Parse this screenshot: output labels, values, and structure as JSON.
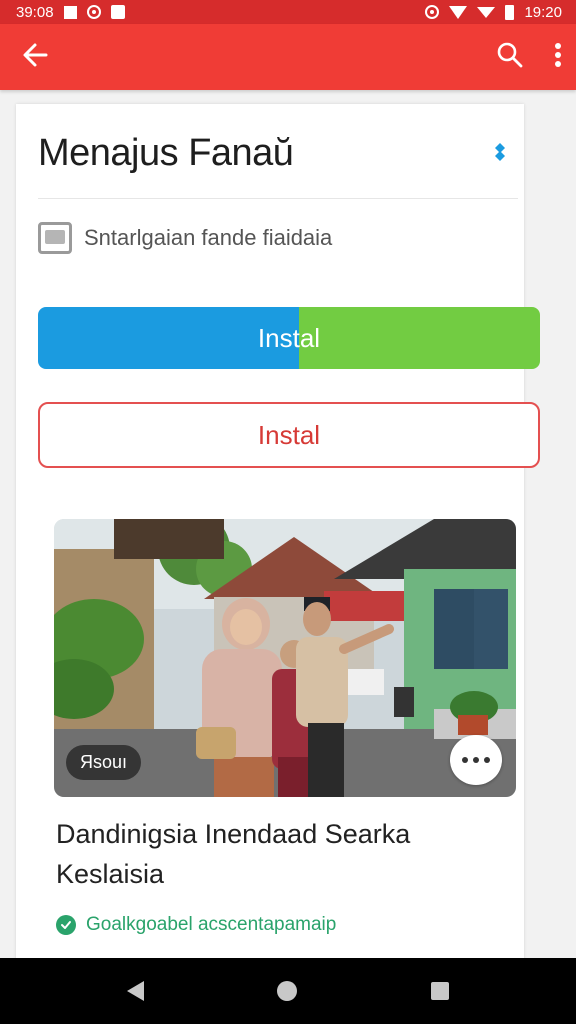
{
  "status_bar": {
    "time_left": "39:08",
    "time_right": "19:20"
  },
  "app_bar": {
    "back_icon": "arrow-left-icon",
    "search_icon": "search-icon",
    "menu_icon": "more-vert-icon",
    "color": "#f03c36"
  },
  "app": {
    "title": "Menajus Fanaŭ",
    "developer": "Sntarlgaian fande fiaidaia",
    "info_icon": "info-dots-icon"
  },
  "buttons": {
    "install_primary": "Instal",
    "install_secondary": "Instal",
    "primary_colors": [
      "#1b9be0",
      "#72cc42"
    ],
    "secondary_color": "#d63a36"
  },
  "media": {
    "badge": "Яsouı",
    "chat_icon": "chat-bubble-icon"
  },
  "caption": "Dandinigsia Inendaad Searka Keslaisia",
  "verified": {
    "text": "Goalkgoabel acscentapamaip",
    "icon": "check-circle-icon",
    "color": "#2aa36b"
  },
  "nav": {
    "back": "back-icon",
    "home": "home-icon",
    "recent": "recent-apps-icon"
  }
}
